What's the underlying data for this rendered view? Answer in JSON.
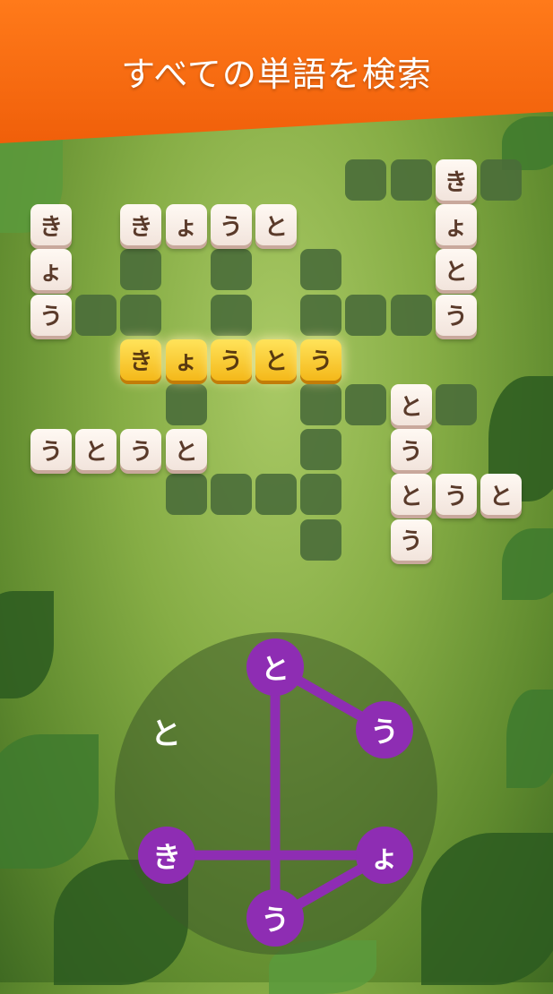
{
  "banner": {
    "title": "すべての単語を検索"
  },
  "grid": {
    "filled_cells": [
      {
        "row": 0,
        "col": 9,
        "char": "き"
      },
      {
        "row": 1,
        "col": 0,
        "char": "き"
      },
      {
        "row": 1,
        "col": 2,
        "char": "き"
      },
      {
        "row": 1,
        "col": 3,
        "char": "ょ"
      },
      {
        "row": 1,
        "col": 4,
        "char": "う"
      },
      {
        "row": 1,
        "col": 5,
        "char": "と"
      },
      {
        "row": 1,
        "col": 9,
        "char": "ょ"
      },
      {
        "row": 2,
        "col": 0,
        "char": "ょ"
      },
      {
        "row": 2,
        "col": 9,
        "char": "と"
      },
      {
        "row": 3,
        "col": 0,
        "char": "う"
      },
      {
        "row": 3,
        "col": 9,
        "char": "う"
      },
      {
        "row": 4,
        "col": 2,
        "char": "き",
        "highlight": true
      },
      {
        "row": 4,
        "col": 3,
        "char": "ょ",
        "highlight": true
      },
      {
        "row": 4,
        "col": 4,
        "char": "う",
        "highlight": true
      },
      {
        "row": 4,
        "col": 5,
        "char": "と",
        "highlight": true
      },
      {
        "row": 4,
        "col": 6,
        "char": "う",
        "highlight": true
      },
      {
        "row": 5,
        "col": 8,
        "char": "と"
      },
      {
        "row": 6,
        "col": 0,
        "char": "う"
      },
      {
        "row": 6,
        "col": 1,
        "char": "と"
      },
      {
        "row": 6,
        "col": 2,
        "char": "う"
      },
      {
        "row": 6,
        "col": 3,
        "char": "と"
      },
      {
        "row": 6,
        "col": 8,
        "char": "う"
      },
      {
        "row": 7,
        "col": 8,
        "char": "と"
      },
      {
        "row": 7,
        "col": 9,
        "char": "う"
      },
      {
        "row": 7,
        "col": 10,
        "char": "と"
      },
      {
        "row": 8,
        "col": 8,
        "char": "う"
      }
    ],
    "empty_cells": [
      [
        0,
        7
      ],
      [
        0,
        8
      ],
      [
        0,
        10
      ],
      [
        2,
        2
      ],
      [
        2,
        4
      ],
      [
        2,
        6
      ],
      [
        3,
        1
      ],
      [
        3,
        2
      ],
      [
        3,
        4
      ],
      [
        3,
        6
      ],
      [
        3,
        7
      ],
      [
        3,
        8
      ],
      [
        5,
        3
      ],
      [
        5,
        6
      ],
      [
        5,
        7
      ],
      [
        5,
        9
      ],
      [
        6,
        6
      ],
      [
        7,
        3
      ],
      [
        7,
        4
      ],
      [
        7,
        5
      ],
      [
        7,
        6
      ],
      [
        8,
        6
      ]
    ]
  },
  "wheel": {
    "preview_text": "と",
    "letters": [
      {
        "char": "と",
        "selected": true
      },
      {
        "char": "う",
        "selected": true
      },
      {
        "char": "ょ",
        "selected": true
      },
      {
        "char": "う",
        "selected": true
      },
      {
        "char": "き",
        "selected": true
      }
    ],
    "path_order": [
      4,
      2,
      3,
      0,
      1
    ],
    "colors": {
      "selected": "#8e2db3",
      "line": "#8e2db3",
      "highlight": "#f4b81a"
    }
  }
}
